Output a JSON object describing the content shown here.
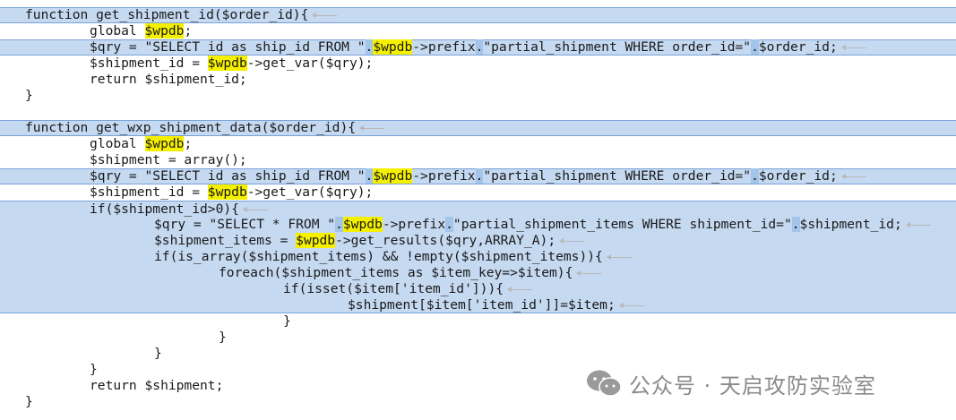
{
  "code_lines": [
    {
      "indent": 0,
      "text": "function get_shipment_id($order_id){"
    },
    {
      "indent": 1,
      "text": "global $wpdb;"
    },
    {
      "indent": 1,
      "text": "$qry = \"SELECT id as ship_id FROM \".$wpdb->prefix.\"partial_shipment WHERE order_id=\".$order_id;"
    },
    {
      "indent": 1,
      "text": "$shipment_id = $wpdb->get_var($qry);"
    },
    {
      "indent": 1,
      "text": "return $shipment_id;"
    },
    {
      "indent": 0,
      "text": "}"
    },
    {
      "indent": 0,
      "text": ""
    },
    {
      "indent": 0,
      "text": "function get_wxp_shipment_data($order_id){"
    },
    {
      "indent": 1,
      "text": "global $wpdb;"
    },
    {
      "indent": 1,
      "text": "$shipment = array();"
    },
    {
      "indent": 1,
      "text": "$qry = \"SELECT id as ship_id FROM \".$wpdb->prefix.\"partial_shipment WHERE order_id=\".$order_id;"
    },
    {
      "indent": 1,
      "text": "$shipment_id = $wpdb->get_var($qry);"
    },
    {
      "indent": 1,
      "text": "if($shipment_id>0){"
    },
    {
      "indent": 2,
      "text": "$qry = \"SELECT * FROM \".$wpdb->prefix.\"partial_shipment_items WHERE shipment_id=\".$shipment_id;"
    },
    {
      "indent": 2,
      "text": "$shipment_items = $wpdb->get_results($qry,ARRAY_A);"
    },
    {
      "indent": 2,
      "text": "if(is_array($shipment_items) && !empty($shipment_items)){"
    },
    {
      "indent": 3,
      "text": "foreach($shipment_items as $item_key=>$item){"
    },
    {
      "indent": 4,
      "text": "if(isset($item['item_id'])){"
    },
    {
      "indent": 5,
      "text": "$shipment[$item['item_id']]=$item;"
    },
    {
      "indent": 4,
      "text": "}"
    },
    {
      "indent": 3,
      "text": "}"
    },
    {
      "indent": 2,
      "text": "}"
    },
    {
      "indent": 1,
      "text": "}"
    },
    {
      "indent": 1,
      "text": "return $shipment;"
    },
    {
      "indent": 0,
      "text": "}"
    }
  ],
  "watermark": {
    "text": "公众号 · 天启攻防实验室",
    "icon": "wechat-icon"
  },
  "colors": {
    "selection": "#c5d9f1",
    "selection_border": "#7aa3d8",
    "search_match": "#f5f000",
    "bracket_match": "#a4c4ea",
    "text": "#1a1a1a",
    "watermark": "#8a8a8a"
  }
}
